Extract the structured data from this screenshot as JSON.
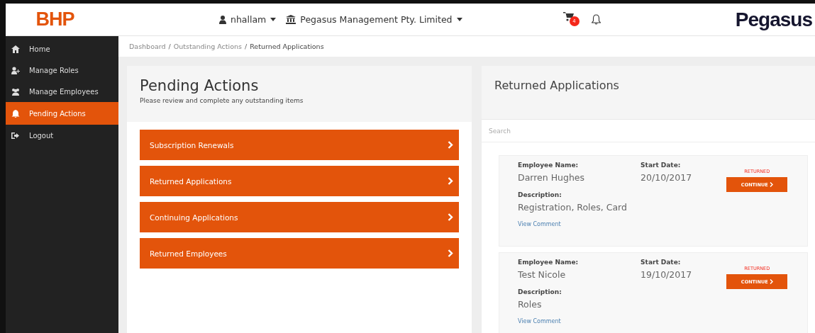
{
  "header": {
    "logo": "BHP",
    "user": "nhallam",
    "company": "Pegasus Management Pty. Limited",
    "cart_count": "4",
    "brand": "Pegasus"
  },
  "sidebar": {
    "items": [
      {
        "label": "Home",
        "selected": false
      },
      {
        "label": "Manage Roles",
        "selected": false
      },
      {
        "label": "Manage Employees",
        "selected": false
      },
      {
        "label": "Pending Actions",
        "selected": true
      },
      {
        "label": "Logout",
        "selected": false
      }
    ]
  },
  "breadcrumb": [
    {
      "label": "Dashboard",
      "current": false
    },
    {
      "separator": "/",
      "label": "Outstanding Actions",
      "current": false
    },
    {
      "separator": "/",
      "label": "Returned Applications",
      "current": true
    }
  ],
  "pending": {
    "title": "Pending Actions",
    "subtitle": "Please review and complete any outstanding items",
    "actions": [
      "Subscription Renewals",
      "Returned Applications",
      "Continuing Applications",
      "Returned Employees"
    ]
  },
  "returned": {
    "title": "Returned Applications",
    "search_placeholder": "Search",
    "cards": [
      {
        "name_label": "Employee Name:",
        "name": "Darren Hughes",
        "date_label": "Start Date:",
        "date": "20/10/2017",
        "desc_label": "Description:",
        "description": "Registration, Roles, Card",
        "link": "View Comment",
        "status": "RETURNED",
        "button": "CONTINUE"
      },
      {
        "name_label": "Employee Name:",
        "name": "Test Nicole",
        "date_label": "Start Date:",
        "date": "19/10/2017",
        "desc_label": "Description:",
        "description": "Roles",
        "link": "View Comment",
        "status": "RETURNED",
        "button": "CONTINUE"
      }
    ]
  }
}
